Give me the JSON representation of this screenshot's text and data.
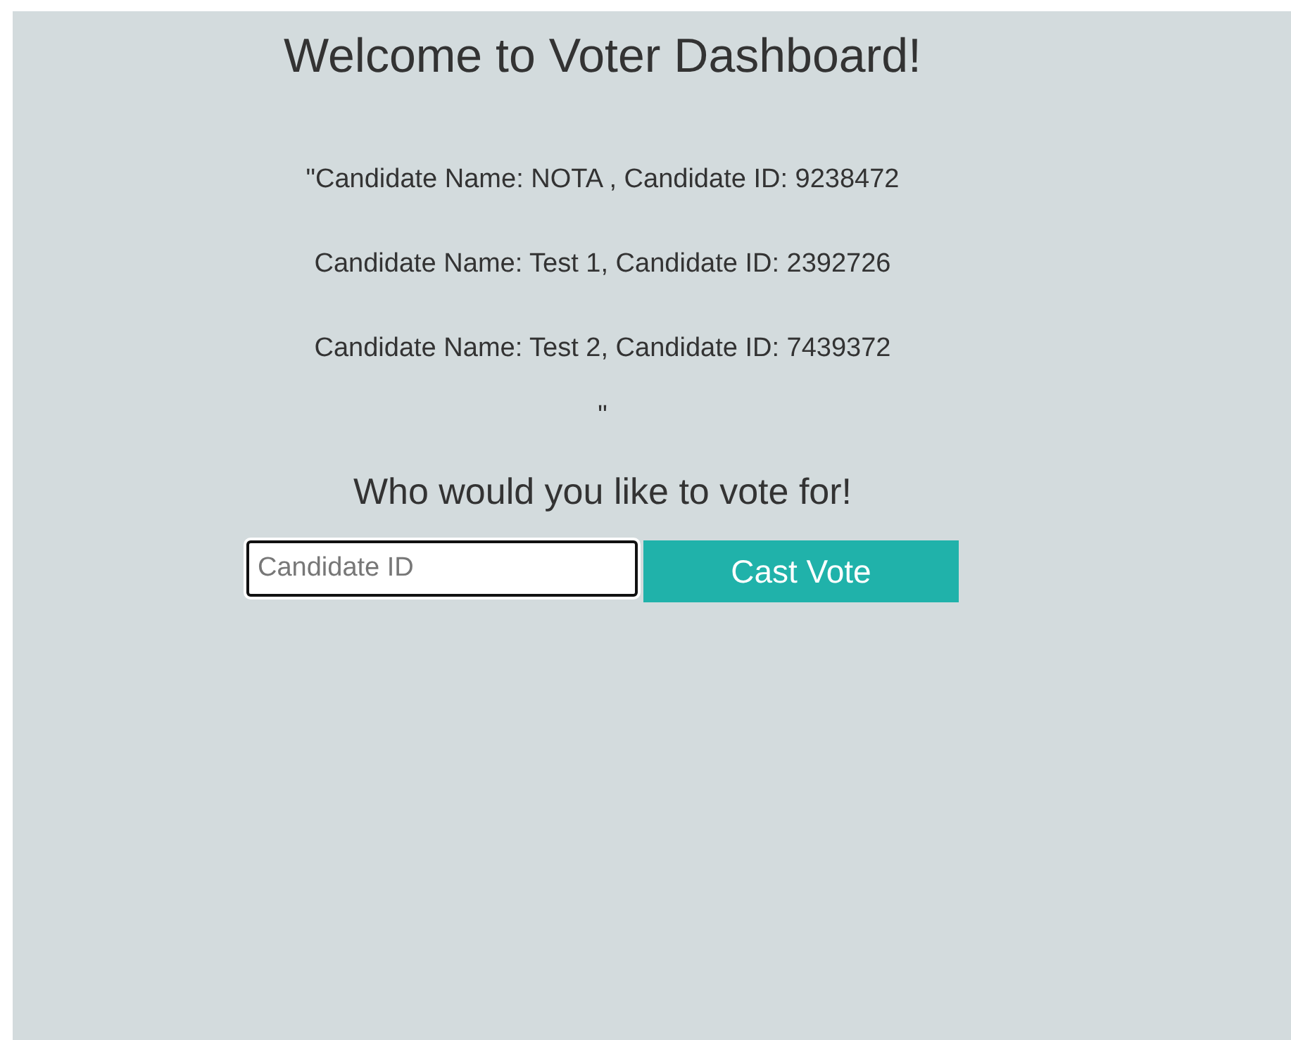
{
  "title": "Welcome to Voter Dashboard!",
  "candidate_lines": [
    "\"Candidate Name: NOTA , Candidate ID: 9238472",
    "Candidate Name: Test 1, Candidate ID: 2392726",
    "Candidate Name: Test 2, Candidate ID: 7439372",
    "\""
  ],
  "prompt": "Who would you like to vote for!",
  "vote_form": {
    "input": {
      "placeholder": "Candidate ID",
      "focused": true
    },
    "button": "Cast Vote"
  }
}
